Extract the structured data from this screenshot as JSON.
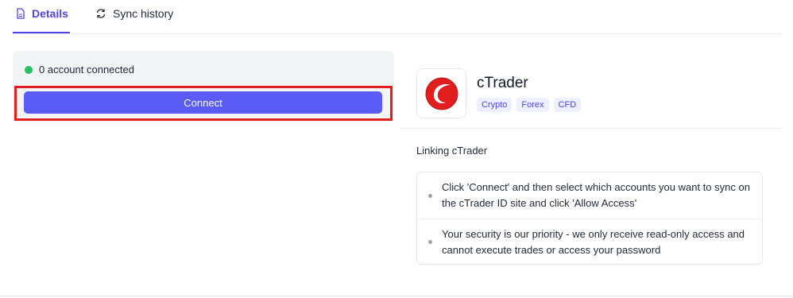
{
  "tabs": [
    {
      "label": "Details",
      "icon": "document-icon",
      "active": true
    },
    {
      "label": "Sync history",
      "icon": "refresh-icon",
      "active": false
    }
  ],
  "connection": {
    "status_text": "0 account connected",
    "status_color": "#22c55e",
    "connect_label": "Connect",
    "button_color": "#5b5cf6"
  },
  "broker": {
    "name": "cTrader",
    "logo_icon": "ctrader-logo-icon",
    "tags": [
      "Crypto",
      "Forex",
      "CFD"
    ]
  },
  "instructions": {
    "title": "Linking cTrader",
    "items": [
      "Click 'Connect' and then select which accounts you want to sync on the cTrader ID site and click 'Allow Access'",
      "Your security is our priority - we only receive read-only access and cannot execute trades or access your password"
    ]
  },
  "colors": {
    "accent": "#4f46e5",
    "highlight": "#e11d1d"
  }
}
